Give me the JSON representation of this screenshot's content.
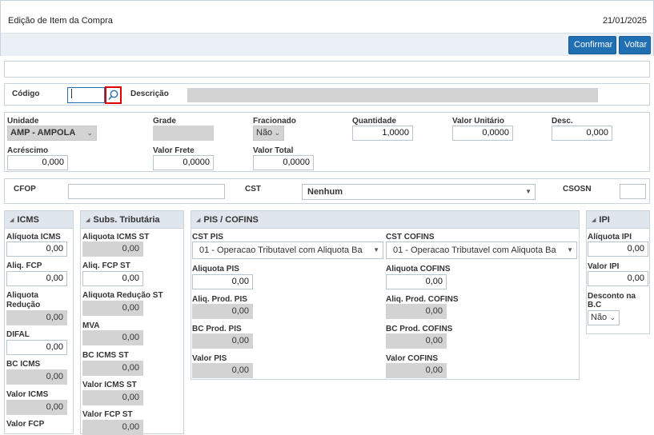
{
  "header": {
    "title": "Edição de Item da Compra",
    "date": "21/01/2025"
  },
  "toolbar": {
    "confirm_label": "Confirmar",
    "back_label": "Voltar"
  },
  "codigo": {
    "label": "Código",
    "value": "",
    "desc_label": "Descrição",
    "desc_value": ""
  },
  "item": {
    "unidade_label": "Unidade",
    "unidade_value": "AMP - AMPOLA",
    "grade_label": "Grade",
    "grade_value": "",
    "fracionado_label": "Fracionado",
    "fracionado_value": "Não",
    "quantidade_label": "Quantidade",
    "quantidade_value": "1,0000",
    "valor_unitario_label": "Valor Unitário",
    "valor_unitario_value": "0,0000",
    "desc_label": "Desc.",
    "desc_value": "0,000",
    "acrescimo_label": "Acréscimo",
    "acrescimo_value": "0,000",
    "valor_frete_label": "Valor Frete",
    "valor_frete_value": "0,0000",
    "valor_total_label": "Valor Total",
    "valor_total_value": "0,0000"
  },
  "fiscal": {
    "cfop_label": "CFOP",
    "cfop_value": "",
    "cst_label": "CST",
    "cst_value": "Nenhum",
    "csosn_label": "CSOSN",
    "csosn_value": ""
  },
  "icms": {
    "title": "ICMS",
    "aliquota_label": "Alíquota ICMS",
    "aliquota_value": "0,00",
    "aliq_fcp_label": "Aliq. FCP",
    "aliq_fcp_value": "0,00",
    "aliquota_reducao_label": "Aliquota Redução",
    "aliquota_reducao_value": "0,00",
    "difal_label": "DIFAL",
    "difal_value": "0,00",
    "bc_label": "BC ICMS",
    "bc_value": "0,00",
    "valor_label": "Valor ICMS",
    "valor_value": "0,00",
    "valor_fcp_label": "Valor FCP"
  },
  "subs": {
    "title": "Subs. Tributária",
    "aliquota_st_label": "Aliquota ICMS ST",
    "aliquota_st_value": "0,00",
    "aliq_fcp_st_label": "Aliq. FCP ST",
    "aliq_fcp_st_value": "0,00",
    "aliquota_reducao_st_label": "Aliquota Redução ST",
    "aliquota_reducao_st_value": "0,00",
    "mva_label": "MVA",
    "mva_value": "0,00",
    "bc_st_label": "BC ICMS ST",
    "bc_st_value": "0,00",
    "valor_st_label": "Valor ICMS ST",
    "valor_st_value": "0,00",
    "valor_fcp_st_label": "Valor FCP ST",
    "valor_fcp_st_value": "0,00"
  },
  "pis": {
    "title": "PIS / COFINS",
    "cst_pis_label": "CST PIS",
    "cst_pis_value": "01 - Operacao Tributavel com Aliquota Ba",
    "cst_cofins_label": "CST COFINS",
    "cst_cofins_value": "01 - Operacao Tributavel com Aliquota Ba",
    "aliquota_pis_label": "Aliquota PIS",
    "aliquota_pis_value": "0,00",
    "aliquota_cofins_label": "Aliquota COFINS",
    "aliquota_cofins_value": "0,00",
    "aliq_prod_pis_label": "Aliq. Prod. PIS",
    "aliq_prod_pis_value": "0,00",
    "aliq_prod_cofins_label": "Aliq. Prod. COFINS",
    "aliq_prod_cofins_value": "0,00",
    "bc_prod_pis_label": "BC Prod. PIS",
    "bc_prod_pis_value": "0,00",
    "bc_prod_cofins_label": "BC Prod. COFINS",
    "bc_prod_cofins_value": "0,00",
    "valor_pis_label": "Valor PIS",
    "valor_pis_value": "0,00",
    "valor_cofins_label": "Valor COFINS",
    "valor_cofins_value": "0,00"
  },
  "ipi": {
    "title": "IPI",
    "aliquota_label": "Alíquota IPI",
    "aliquota_value": "0,00",
    "valor_label": "Valor IPI",
    "valor_value": "0,00",
    "desconto_label_1": "Desconto na",
    "desconto_label_2": "B.C",
    "desconto_value": "Não"
  },
  "colors": {
    "accent": "#1f6fb2",
    "highlight": "#e00000",
    "section_head": "#dfe6ee"
  },
  "icons": {
    "search": "magnifier-icon",
    "dropdown": "chevron-down-icon",
    "collapse": "triangle-icon"
  }
}
